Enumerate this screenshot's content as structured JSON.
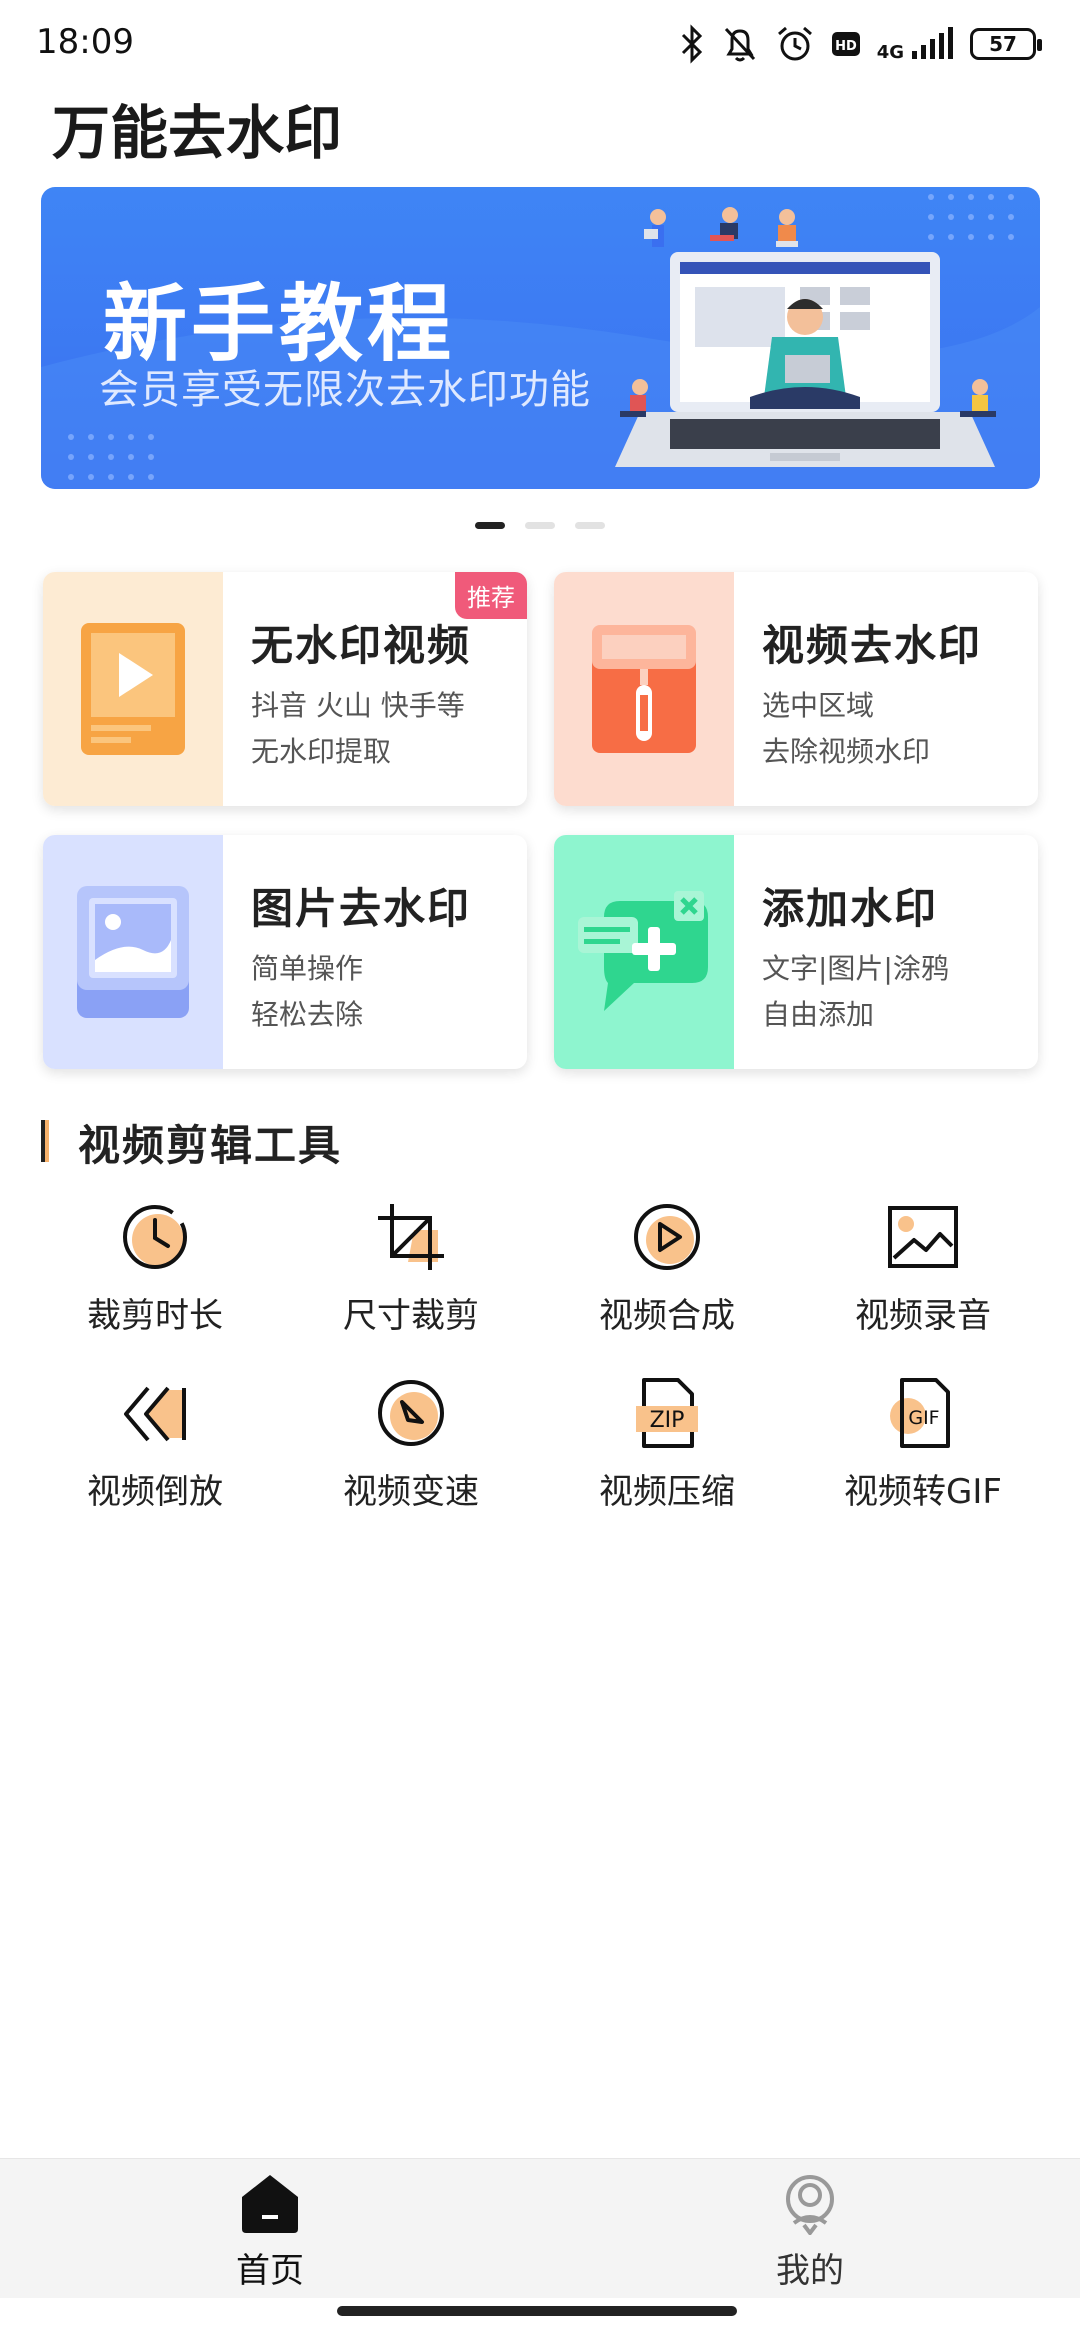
{
  "status_bar": {
    "time": "18:09",
    "network": "4G",
    "battery": "57"
  },
  "app": {
    "title": "万能去水印"
  },
  "banner": {
    "title": "新手教程",
    "subtitle": "会员享受无限次去水印功能",
    "page_count": 3,
    "active_page": 0
  },
  "features": [
    {
      "title": "无水印视频",
      "line1": "抖音 火山 快手等",
      "line2": "无水印提取",
      "badge": "推荐",
      "icon": "video-doc-icon",
      "bg": "#fdebd3"
    },
    {
      "title": "视频去水印",
      "line1": "选中区域",
      "line2": "去除视频水印",
      "icon": "paint-roller-icon",
      "bg": "#fddccf"
    },
    {
      "title": "图片去水印",
      "line1": "简单操作",
      "line2": "轻松去除",
      "icon": "image-frame-icon",
      "bg": "#d9e1ff"
    },
    {
      "title": "添加水印",
      "line1": "文字|图片|涂鸦",
      "line2": "自由添加",
      "icon": "chat-plus-icon",
      "bg": "#8ef5cf"
    }
  ],
  "section": {
    "title": "视频剪辑工具"
  },
  "tools": [
    {
      "label": "裁剪时长",
      "icon": "clock-icon"
    },
    {
      "label": "尺寸裁剪",
      "icon": "crop-icon"
    },
    {
      "label": "视频合成",
      "icon": "play-circle-icon"
    },
    {
      "label": "视频录音",
      "icon": "picture-icon"
    },
    {
      "label": "视频倒放",
      "icon": "rewind-icon"
    },
    {
      "label": "视频变速",
      "icon": "compass-icon"
    },
    {
      "label": "视频压缩",
      "icon": "zip-file-icon"
    },
    {
      "label": "视频转GIF",
      "icon": "gif-file-icon"
    }
  ],
  "bottom_nav": [
    {
      "label": "首页",
      "icon": "home-icon",
      "active": true
    },
    {
      "label": "我的",
      "icon": "profile-icon",
      "active": false
    }
  ],
  "colors": {
    "accent": "#f7b26c",
    "banner": "#3d7af2",
    "badge": "#f05a7a"
  }
}
